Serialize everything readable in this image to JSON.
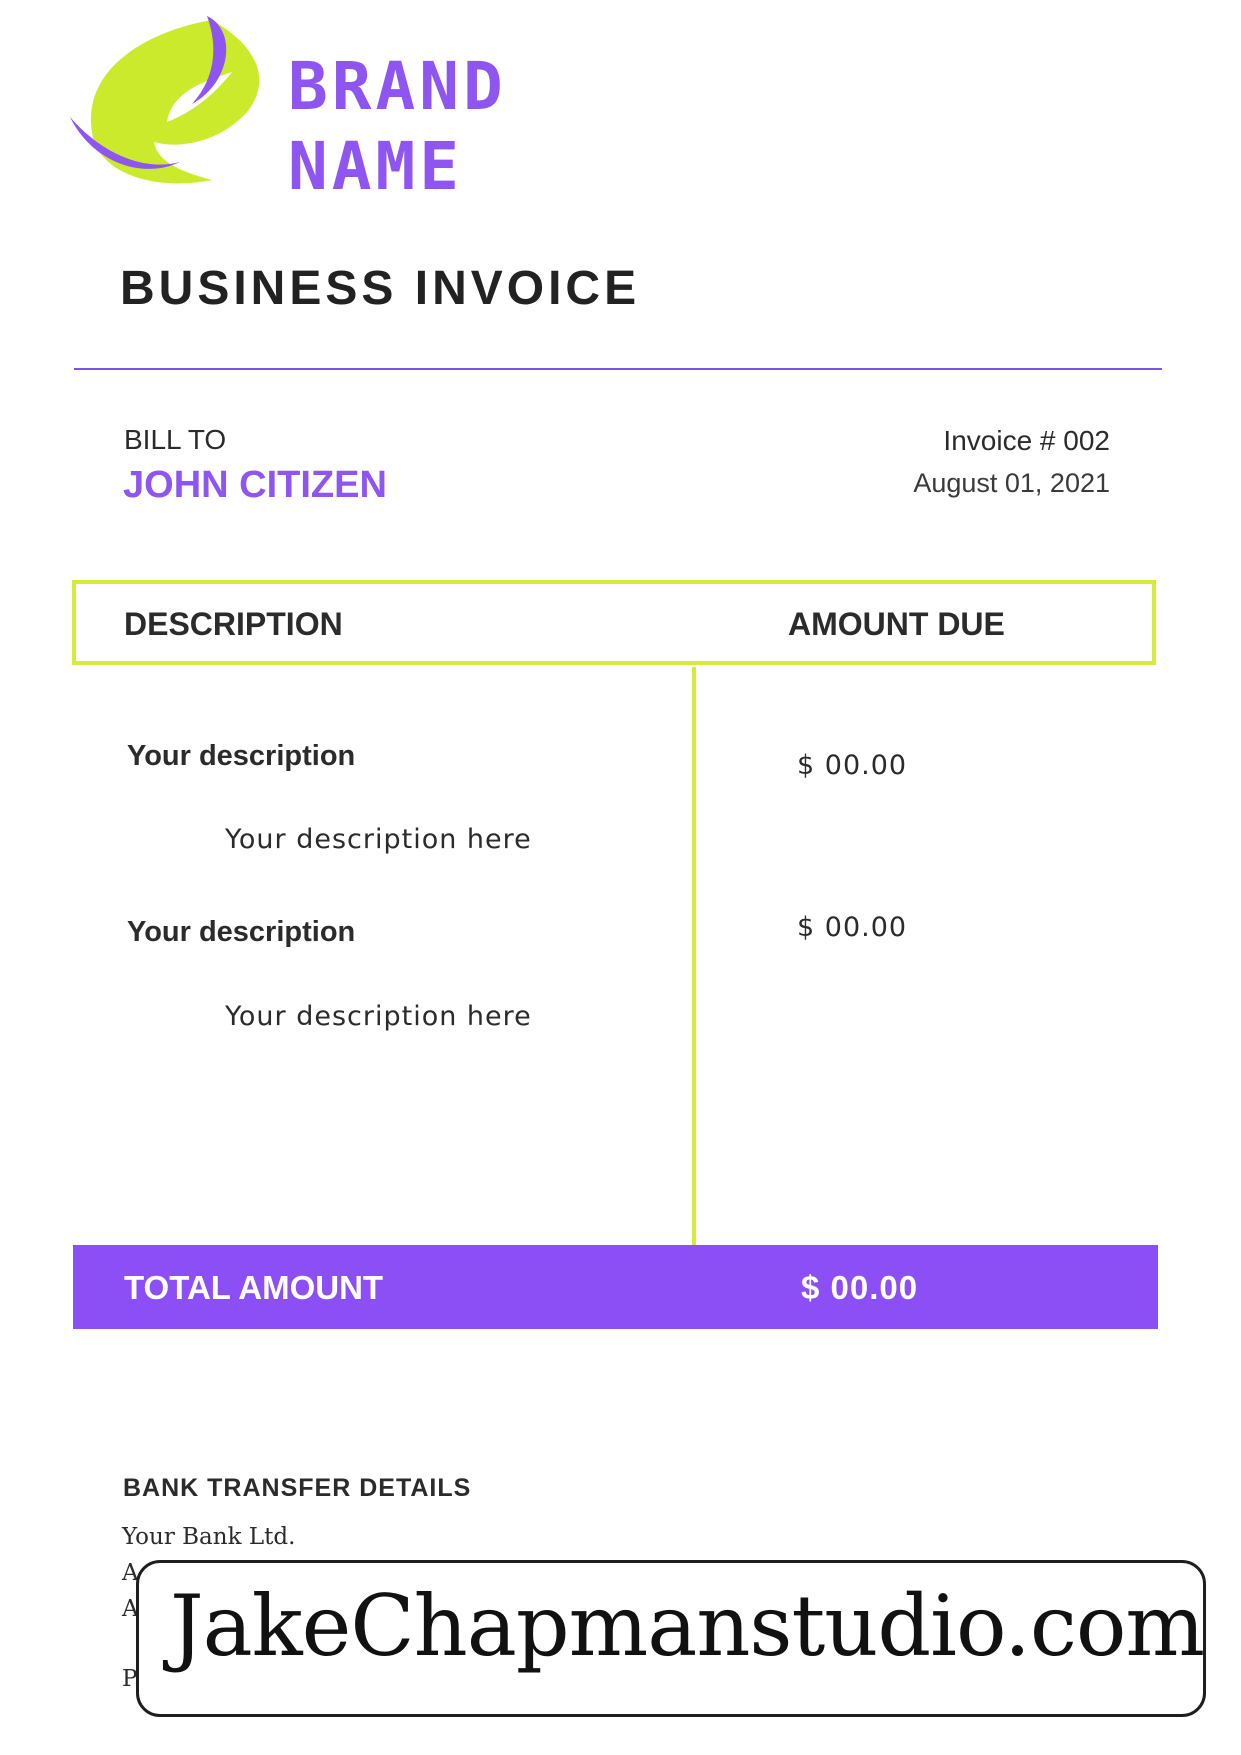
{
  "brand": {
    "line1": "BRAND",
    "line2": "NAME",
    "colors": {
      "primary": "#8f55f0",
      "accent": "#d6eb3d"
    },
    "logo_icon": "leaf-swoosh-logo"
  },
  "document": {
    "title": "BUSINESS INVOICE"
  },
  "bill_to": {
    "label": "BILL TO",
    "name": "JOHN CITIZEN"
  },
  "invoice": {
    "number": "Invoice # 002",
    "date": "August 01, 2021"
  },
  "table": {
    "headers": {
      "description": "DESCRIPTION",
      "amount": "AMOUNT DUE"
    },
    "items": [
      {
        "title": "Your description",
        "subtitle": "Your description here",
        "amount": "$ 00.00"
      },
      {
        "title": "Your description",
        "subtitle": "Your description here",
        "amount": "$ 00.00"
      }
    ]
  },
  "total": {
    "label": "TOTAL AMOUNT",
    "value": "$ 00.00"
  },
  "bank": {
    "heading": "BANK TRANSFER DETAILS",
    "name": "Your Bank Ltd.",
    "partial_lines": [
      "A",
      "A",
      "P"
    ]
  },
  "watermark": {
    "text": "JakeChapmanstudio.com"
  }
}
